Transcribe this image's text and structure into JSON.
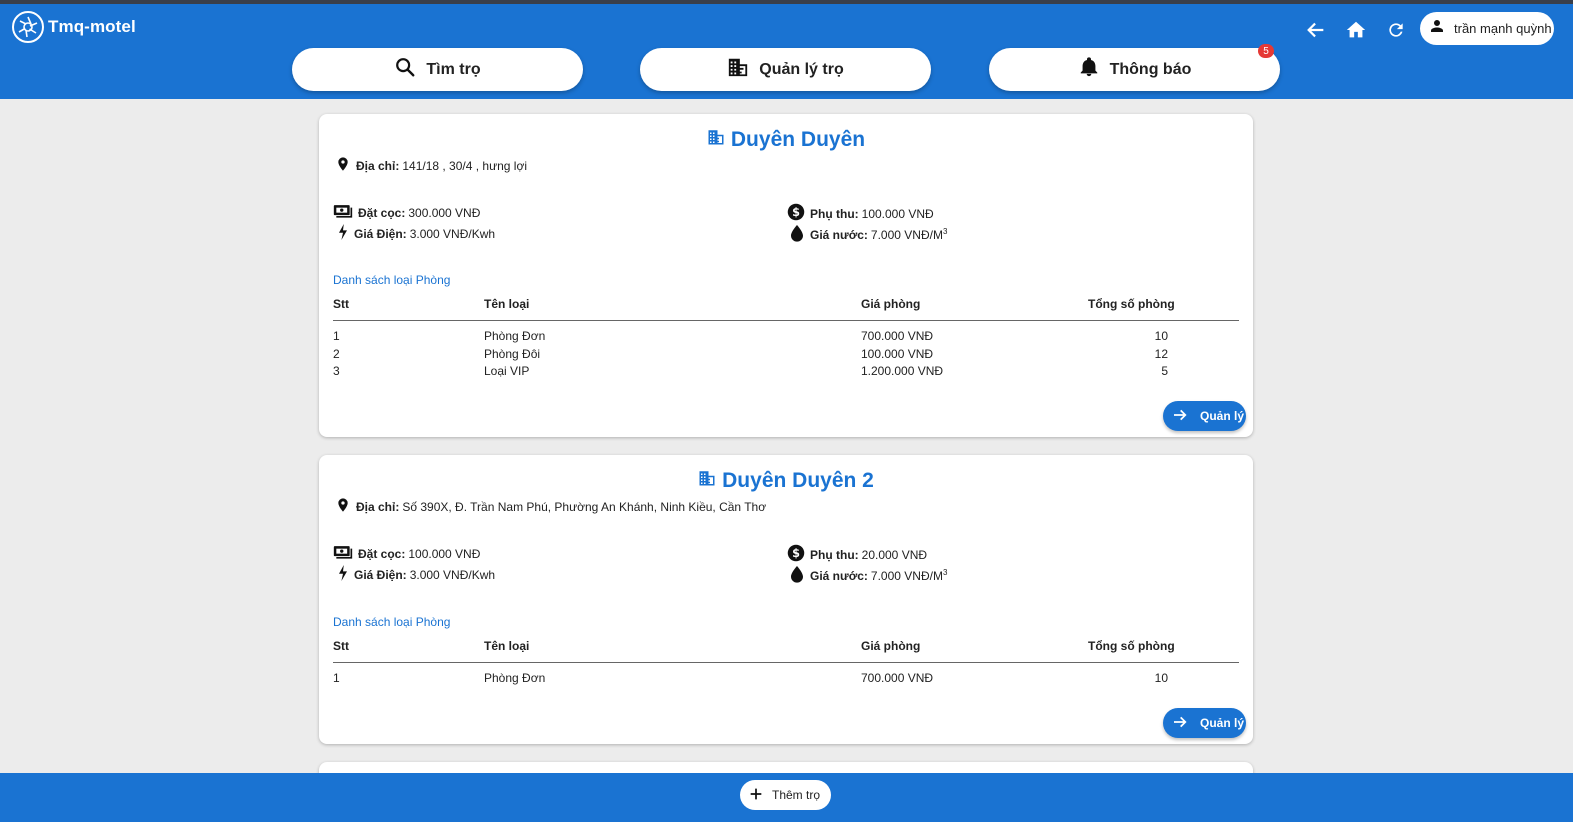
{
  "app": {
    "title": "Tmq-motel",
    "logo_icon": "aperture-logo-icon"
  },
  "nav": {
    "search_label": "Tìm trọ",
    "manage_label": "Quản lý trọ",
    "notify_label": "Thông báo",
    "notify_count": "5"
  },
  "user": {
    "name": "trần mạnh quỳnh"
  },
  "colors": {
    "primary": "#1a73d2",
    "badge": "#e53935",
    "background": "#ececec"
  },
  "motels": [
    {
      "name": "Duyên Duyên",
      "address_label": "Địa chỉ:",
      "address": "141/18 , 30/4 , hưng lợi",
      "deposit_label": "Đặt cọc:",
      "deposit": "300.000 VNĐ",
      "surcharge_label": "Phụ thu:",
      "surcharge": "100.000 VNĐ",
      "electric_label": "Giá Điện:",
      "electric": "3.000 VNĐ/Kwh",
      "water_label": "Giá nước:",
      "water": "7.000 VNĐ/M",
      "water_unit_sup": "3",
      "room_list_title": "Danh sách loại Phòng",
      "columns": [
        "Stt",
        "Tên loại",
        "Giá phòng",
        "Tổng số phòng"
      ],
      "rooms": [
        {
          "stt": "1",
          "type": "Phòng Đơn",
          "price": "700.000 VNĐ",
          "count": "10"
        },
        {
          "stt": "2",
          "type": "Phòng Đôi",
          "price": "100.000 VNĐ",
          "count": "12"
        },
        {
          "stt": "3",
          "type": "Loại VIP",
          "price": "1.200.000 VNĐ",
          "count": "5"
        }
      ],
      "manage_label": "Quản lý"
    },
    {
      "name": "Duyên Duyên 2",
      "address_label": "Địa chỉ:",
      "address": "Số 390X, Đ. Trần Nam Phú, Phường An Khánh, Ninh Kiều, Cần Thơ",
      "deposit_label": "Đặt cọc:",
      "deposit": "100.000 VNĐ",
      "surcharge_label": "Phụ thu:",
      "surcharge": "20.000 VNĐ",
      "electric_label": "Giá Điện:",
      "electric": "3.000 VNĐ/Kwh",
      "water_label": "Giá nước:",
      "water": "7.000 VNĐ/M",
      "water_unit_sup": "3",
      "room_list_title": "Danh sách loại Phòng",
      "columns": [
        "Stt",
        "Tên loại",
        "Giá phòng",
        "Tổng số phòng"
      ],
      "rooms": [
        {
          "stt": "1",
          "type": "Phòng Đơn",
          "price": "700.000 VNĐ",
          "count": "10"
        }
      ],
      "manage_label": "Quản lý"
    }
  ],
  "footer": {
    "add_label": "Thêm trọ"
  }
}
